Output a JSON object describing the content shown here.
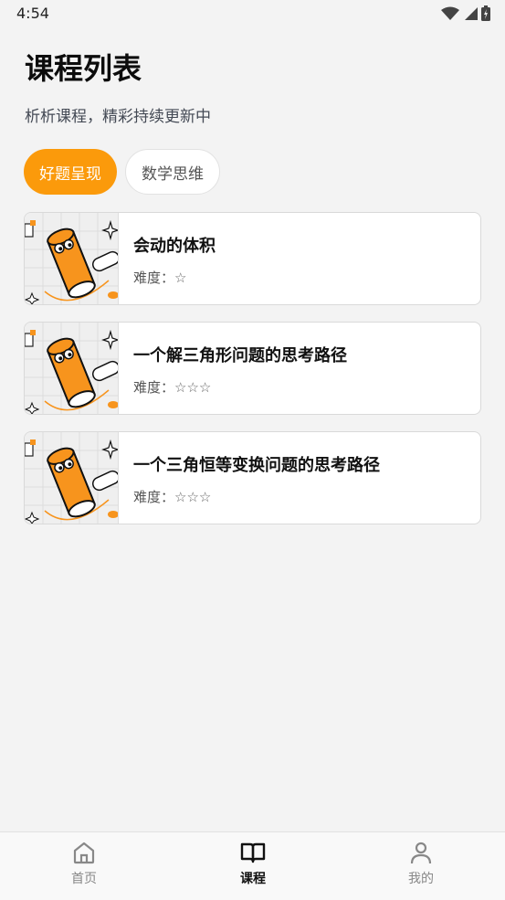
{
  "status_bar": {
    "time": "4:54"
  },
  "header": {
    "title": "课程列表",
    "subtitle": "析析课程，精彩持续更新中"
  },
  "tabs": [
    {
      "label": "好题呈现",
      "active": true
    },
    {
      "label": "数学思维",
      "active": false
    }
  ],
  "difficulty_label": "难度：",
  "courses": [
    {
      "title": "会动的体积",
      "stars": "☆",
      "thumb": "cylinder-cartoon-image"
    },
    {
      "title": "一个解三角形问题的思考路径",
      "stars": "☆☆☆",
      "thumb": "cylinder-cartoon-image"
    },
    {
      "title": "一个三角恒等变换问题的思考路径",
      "stars": "☆☆☆",
      "thumb": "cylinder-cartoon-image"
    }
  ],
  "bottom_nav": [
    {
      "label": "首页",
      "icon": "home-icon",
      "active": false
    },
    {
      "label": "课程",
      "icon": "book-icon",
      "active": true
    },
    {
      "label": "我的",
      "icon": "user-icon",
      "active": false
    }
  ],
  "colors": {
    "accent": "#fb9a0b",
    "background": "#f3f3f3"
  }
}
